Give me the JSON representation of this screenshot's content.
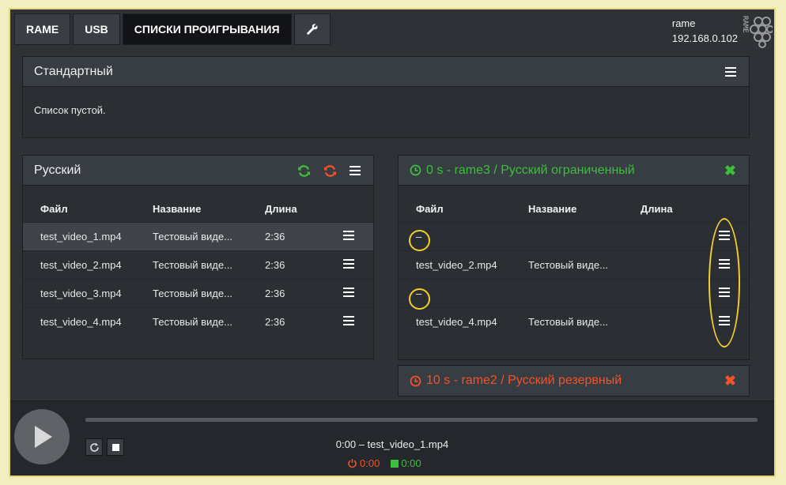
{
  "nav": {
    "tabs": [
      {
        "label": "RAME"
      },
      {
        "label": "USB"
      },
      {
        "label": "СПИСКИ ПРОИГРЫВАНИЯ"
      }
    ],
    "tool_icon": "wrench-icon"
  },
  "host": {
    "name": "rame",
    "ip": "192.168.0.102",
    "logo_text": "RAME"
  },
  "standard": {
    "title": "Стандартный",
    "empty_text": "Список пустой."
  },
  "russian": {
    "title": "Русский",
    "columns": [
      "Файл",
      "Название",
      "Длина"
    ],
    "rows": [
      {
        "file": "test_video_1.mp4",
        "name": "Тестовый виде...",
        "length": "2:36"
      },
      {
        "file": "test_video_2.mp4",
        "name": "Тестовый виде...",
        "length": "2:36"
      },
      {
        "file": "test_video_3.mp4",
        "name": "Тестовый виде...",
        "length": "2:36"
      },
      {
        "file": "test_video_4.mp4",
        "name": "Тестовый виде...",
        "length": "2:36"
      }
    ]
  },
  "limited": {
    "title": "0 s - rame3 / Русский ограниченный",
    "columns": [
      "Файл",
      "Название",
      "Длина"
    ],
    "rows": [
      {
        "file": "–",
        "name": "",
        "length": ""
      },
      {
        "file": "test_video_2.mp4",
        "name": "Тестовый виде...",
        "length": ""
      },
      {
        "file": "–",
        "name": "",
        "length": ""
      },
      {
        "file": "test_video_4.mp4",
        "name": "Тестовый виде...",
        "length": ""
      }
    ]
  },
  "reserve": {
    "title": "10 s - rame2 / Русский резервный"
  },
  "player": {
    "now_playing": "0:00 – test_video_1.mp4",
    "time_red": "0:00",
    "time_green": "0:00",
    "progress": 0
  },
  "colors": {
    "accent_green": "#3cbf3c",
    "accent_red": "#f0532a",
    "highlight": "#f2cf2a"
  }
}
